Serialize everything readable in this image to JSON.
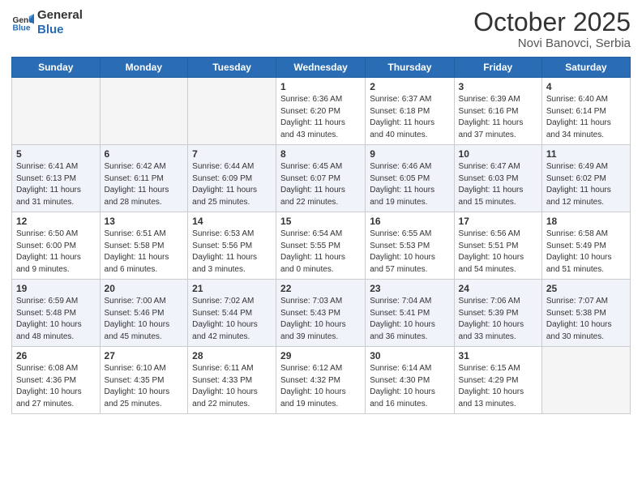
{
  "logo": {
    "line1": "General",
    "line2": "Blue"
  },
  "header": {
    "month": "October 2025",
    "location": "Novi Banovci, Serbia"
  },
  "weekdays": [
    "Sunday",
    "Monday",
    "Tuesday",
    "Wednesday",
    "Thursday",
    "Friday",
    "Saturday"
  ],
  "weeks": [
    [
      {
        "day": "",
        "info": ""
      },
      {
        "day": "",
        "info": ""
      },
      {
        "day": "",
        "info": ""
      },
      {
        "day": "1",
        "info": "Sunrise: 6:36 AM\nSunset: 6:20 PM\nDaylight: 11 hours\nand 43 minutes."
      },
      {
        "day": "2",
        "info": "Sunrise: 6:37 AM\nSunset: 6:18 PM\nDaylight: 11 hours\nand 40 minutes."
      },
      {
        "day": "3",
        "info": "Sunrise: 6:39 AM\nSunset: 6:16 PM\nDaylight: 11 hours\nand 37 minutes."
      },
      {
        "day": "4",
        "info": "Sunrise: 6:40 AM\nSunset: 6:14 PM\nDaylight: 11 hours\nand 34 minutes."
      }
    ],
    [
      {
        "day": "5",
        "info": "Sunrise: 6:41 AM\nSunset: 6:13 PM\nDaylight: 11 hours\nand 31 minutes."
      },
      {
        "day": "6",
        "info": "Sunrise: 6:42 AM\nSunset: 6:11 PM\nDaylight: 11 hours\nand 28 minutes."
      },
      {
        "day": "7",
        "info": "Sunrise: 6:44 AM\nSunset: 6:09 PM\nDaylight: 11 hours\nand 25 minutes."
      },
      {
        "day": "8",
        "info": "Sunrise: 6:45 AM\nSunset: 6:07 PM\nDaylight: 11 hours\nand 22 minutes."
      },
      {
        "day": "9",
        "info": "Sunrise: 6:46 AM\nSunset: 6:05 PM\nDaylight: 11 hours\nand 19 minutes."
      },
      {
        "day": "10",
        "info": "Sunrise: 6:47 AM\nSunset: 6:03 PM\nDaylight: 11 hours\nand 15 minutes."
      },
      {
        "day": "11",
        "info": "Sunrise: 6:49 AM\nSunset: 6:02 PM\nDaylight: 11 hours\nand 12 minutes."
      }
    ],
    [
      {
        "day": "12",
        "info": "Sunrise: 6:50 AM\nSunset: 6:00 PM\nDaylight: 11 hours\nand 9 minutes."
      },
      {
        "day": "13",
        "info": "Sunrise: 6:51 AM\nSunset: 5:58 PM\nDaylight: 11 hours\nand 6 minutes."
      },
      {
        "day": "14",
        "info": "Sunrise: 6:53 AM\nSunset: 5:56 PM\nDaylight: 11 hours\nand 3 minutes."
      },
      {
        "day": "15",
        "info": "Sunrise: 6:54 AM\nSunset: 5:55 PM\nDaylight: 11 hours\nand 0 minutes."
      },
      {
        "day": "16",
        "info": "Sunrise: 6:55 AM\nSunset: 5:53 PM\nDaylight: 10 hours\nand 57 minutes."
      },
      {
        "day": "17",
        "info": "Sunrise: 6:56 AM\nSunset: 5:51 PM\nDaylight: 10 hours\nand 54 minutes."
      },
      {
        "day": "18",
        "info": "Sunrise: 6:58 AM\nSunset: 5:49 PM\nDaylight: 10 hours\nand 51 minutes."
      }
    ],
    [
      {
        "day": "19",
        "info": "Sunrise: 6:59 AM\nSunset: 5:48 PM\nDaylight: 10 hours\nand 48 minutes."
      },
      {
        "day": "20",
        "info": "Sunrise: 7:00 AM\nSunset: 5:46 PM\nDaylight: 10 hours\nand 45 minutes."
      },
      {
        "day": "21",
        "info": "Sunrise: 7:02 AM\nSunset: 5:44 PM\nDaylight: 10 hours\nand 42 minutes."
      },
      {
        "day": "22",
        "info": "Sunrise: 7:03 AM\nSunset: 5:43 PM\nDaylight: 10 hours\nand 39 minutes."
      },
      {
        "day": "23",
        "info": "Sunrise: 7:04 AM\nSunset: 5:41 PM\nDaylight: 10 hours\nand 36 minutes."
      },
      {
        "day": "24",
        "info": "Sunrise: 7:06 AM\nSunset: 5:39 PM\nDaylight: 10 hours\nand 33 minutes."
      },
      {
        "day": "25",
        "info": "Sunrise: 7:07 AM\nSunset: 5:38 PM\nDaylight: 10 hours\nand 30 minutes."
      }
    ],
    [
      {
        "day": "26",
        "info": "Sunrise: 6:08 AM\nSunset: 4:36 PM\nDaylight: 10 hours\nand 27 minutes."
      },
      {
        "day": "27",
        "info": "Sunrise: 6:10 AM\nSunset: 4:35 PM\nDaylight: 10 hours\nand 25 minutes."
      },
      {
        "day": "28",
        "info": "Sunrise: 6:11 AM\nSunset: 4:33 PM\nDaylight: 10 hours\nand 22 minutes."
      },
      {
        "day": "29",
        "info": "Sunrise: 6:12 AM\nSunset: 4:32 PM\nDaylight: 10 hours\nand 19 minutes."
      },
      {
        "day": "30",
        "info": "Sunrise: 6:14 AM\nSunset: 4:30 PM\nDaylight: 10 hours\nand 16 minutes."
      },
      {
        "day": "31",
        "info": "Sunrise: 6:15 AM\nSunset: 4:29 PM\nDaylight: 10 hours\nand 13 minutes."
      },
      {
        "day": "",
        "info": ""
      }
    ]
  ]
}
